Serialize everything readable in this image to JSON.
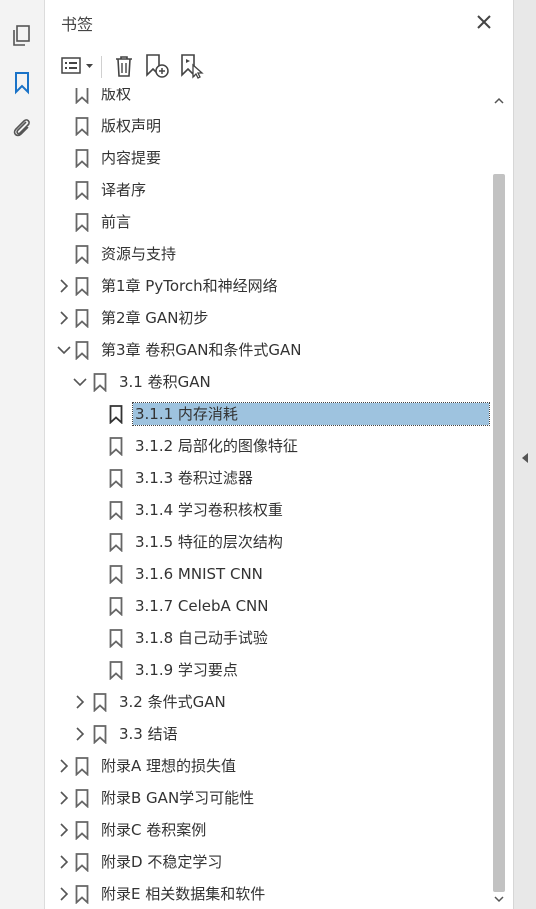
{
  "panel": {
    "title": "书签"
  },
  "toolbar": {
    "options_icon": "list-options-icon",
    "delete_icon": "trash-icon",
    "new_bookmark_icon": "new-bookmark-icon",
    "bookmark_from_selection_icon": "bookmark-select-icon"
  },
  "rail": {
    "icons": [
      "pages-icon",
      "bookmarks-icon",
      "attachments-icon"
    ],
    "accent": "#1a73c8"
  },
  "colors": {
    "selected_bg": "#9ec3df",
    "rail_bg": "#f3f3f3",
    "strip_bg": "#e8e8e8"
  },
  "bookmarks": [
    {
      "label": "版权",
      "level": 0,
      "expander": "none"
    },
    {
      "label": "版权声明",
      "level": 0,
      "expander": "none"
    },
    {
      "label": "内容提要",
      "level": 0,
      "expander": "none"
    },
    {
      "label": "译者序",
      "level": 0,
      "expander": "none"
    },
    {
      "label": "前言",
      "level": 0,
      "expander": "none"
    },
    {
      "label": "资源与支持",
      "level": 0,
      "expander": "none"
    },
    {
      "label": "第1章 PyTorch和神经网络",
      "level": 0,
      "expander": "collapsed"
    },
    {
      "label": "第2章 GAN初步",
      "level": 0,
      "expander": "collapsed"
    },
    {
      "label": "第3章 卷积GAN和条件式GAN",
      "level": 0,
      "expander": "expanded"
    },
    {
      "label": "3.1 卷积GAN",
      "level": 1,
      "expander": "expanded"
    },
    {
      "label": "3.1.1 内存消耗",
      "level": 2,
      "expander": "none",
      "selected": true
    },
    {
      "label": "3.1.2 局部化的图像特征",
      "level": 2,
      "expander": "none"
    },
    {
      "label": "3.1.3 卷积过滤器",
      "level": 2,
      "expander": "none"
    },
    {
      "label": "3.1.4 学习卷积核权重",
      "level": 2,
      "expander": "none"
    },
    {
      "label": "3.1.5 特征的层次结构",
      "level": 2,
      "expander": "none"
    },
    {
      "label": "3.1.6 MNIST CNN",
      "level": 2,
      "expander": "none"
    },
    {
      "label": "3.1.7 CelebA CNN",
      "level": 2,
      "expander": "none"
    },
    {
      "label": "3.1.8 自己动手试验",
      "level": 2,
      "expander": "none"
    },
    {
      "label": "3.1.9 学习要点",
      "level": 2,
      "expander": "none"
    },
    {
      "label": "3.2 条件式GAN",
      "level": 1,
      "expander": "collapsed"
    },
    {
      "label": "3.3 结语",
      "level": 1,
      "expander": "collapsed"
    },
    {
      "label": "附录A 理想的损失值",
      "level": 0,
      "expander": "collapsed"
    },
    {
      "label": "附录B GAN学习可能性",
      "level": 0,
      "expander": "collapsed"
    },
    {
      "label": "附录C 卷积案例",
      "level": 0,
      "expander": "collapsed"
    },
    {
      "label": "附录D 不稳定学习",
      "level": 0,
      "expander": "collapsed"
    },
    {
      "label": "附录E 相关数据集和软件",
      "level": 0,
      "expander": "collapsed"
    }
  ]
}
